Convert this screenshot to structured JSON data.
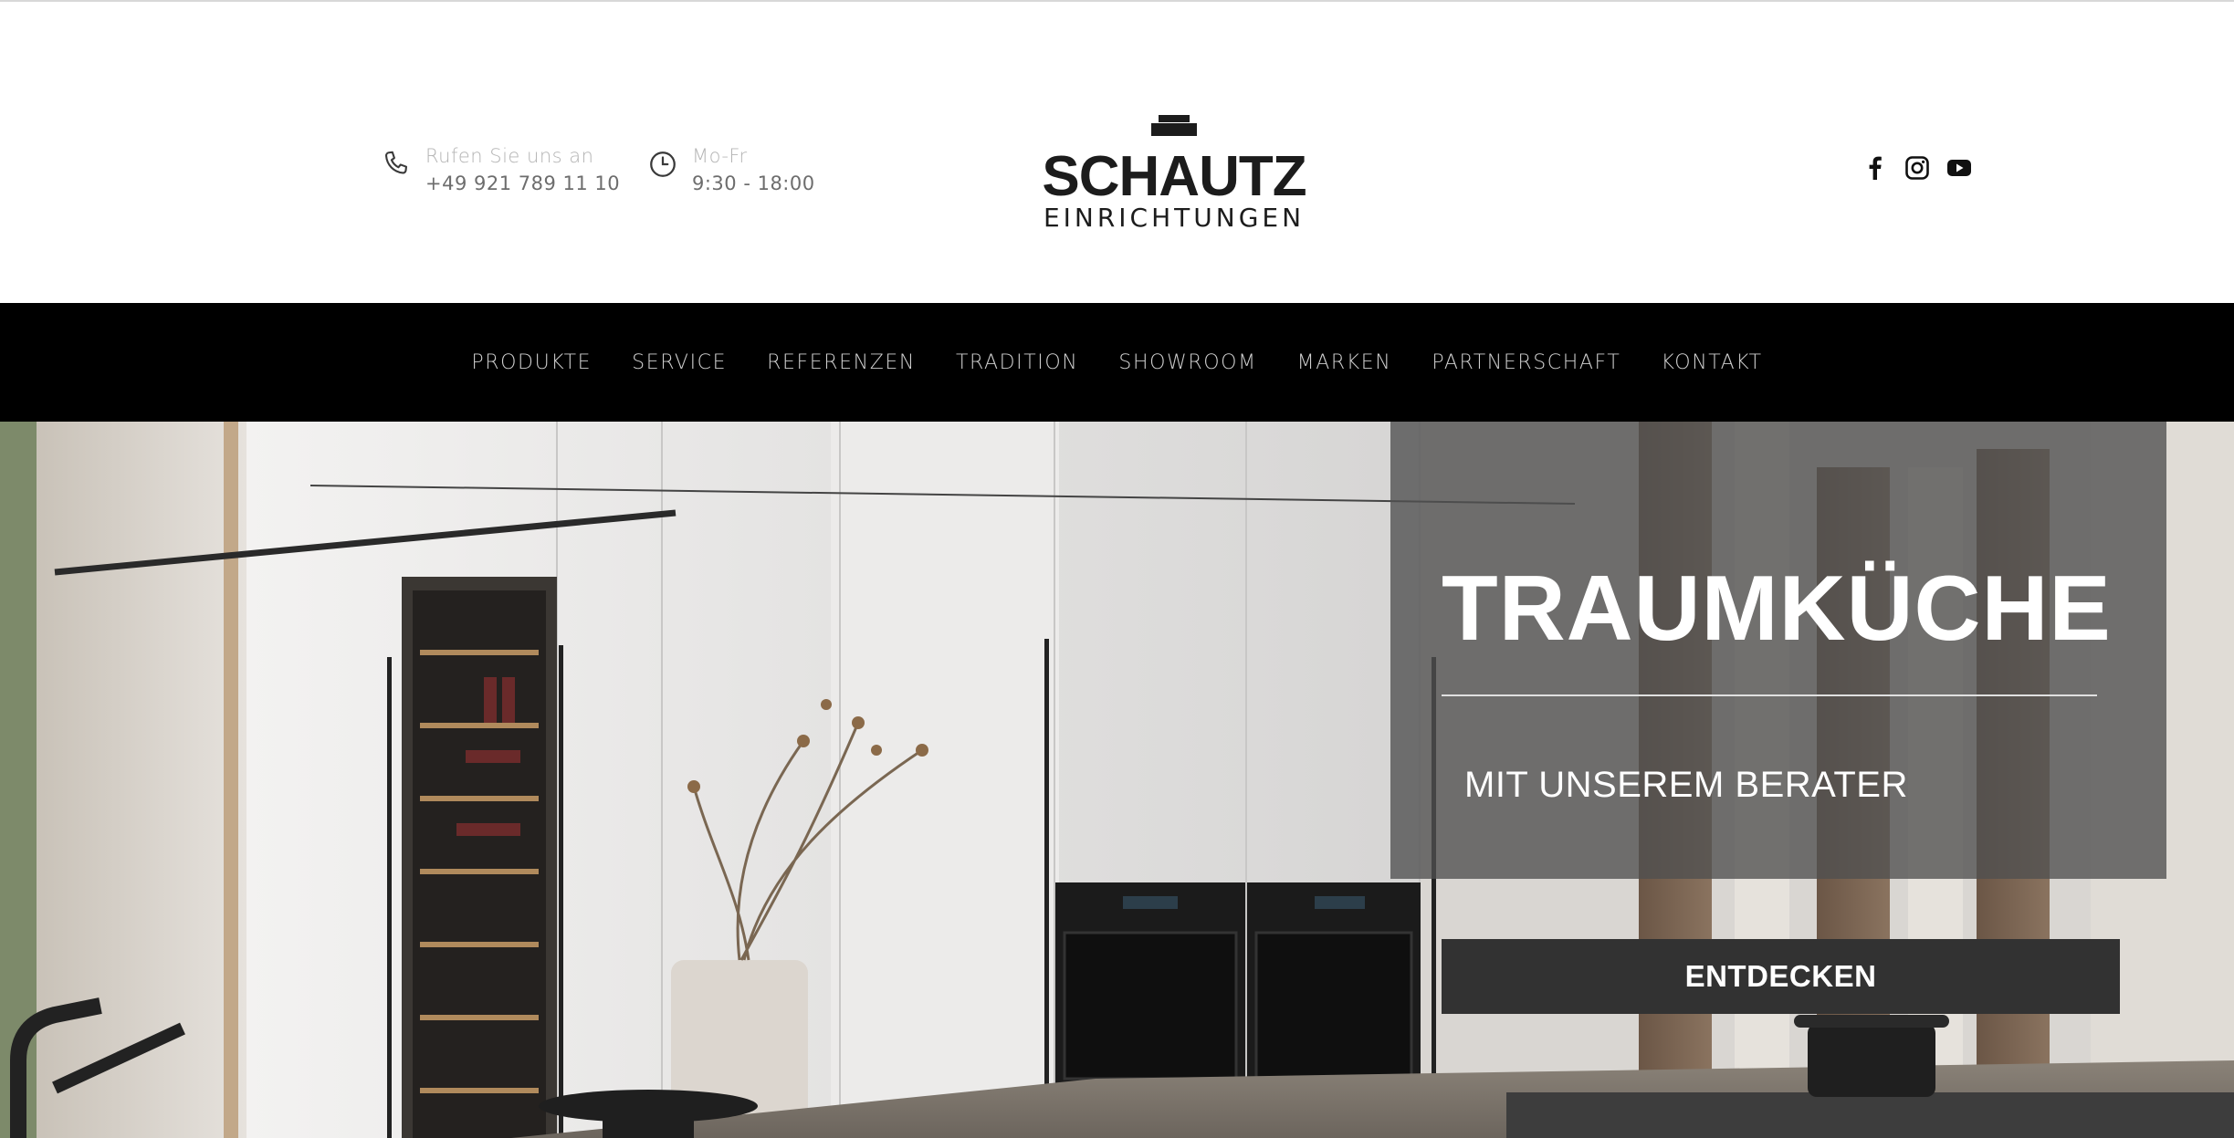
{
  "header": {
    "phone": {
      "icon": "phone-icon",
      "label": "Rufen Sie uns an",
      "number": "+49 921 789 11 10"
    },
    "hours": {
      "icon": "clock-icon",
      "label": "Mo-Fr",
      "time": "9:30 - 18:00"
    },
    "logo": {
      "name": "SCHAUTZ",
      "tagline": "EINRICHTUNGEN"
    },
    "social": [
      {
        "icon": "facebook-icon"
      },
      {
        "icon": "instagram-icon"
      },
      {
        "icon": "youtube-icon"
      }
    ]
  },
  "nav": {
    "items": [
      {
        "label": "PRODUKTE"
      },
      {
        "label": "SERVICE"
      },
      {
        "label": "REFERENZEN"
      },
      {
        "label": "TRADITION"
      },
      {
        "label": "SHOWROOM"
      },
      {
        "label": "MARKEN"
      },
      {
        "label": "PARTNERSCHAFT"
      },
      {
        "label": "KONTAKT"
      }
    ]
  },
  "hero": {
    "title": "TRAUMKÜCHE",
    "subtitle": "MIT UNSEREM BERATER",
    "cta_label": "ENTDECKEN"
  },
  "colors": {
    "nav_bg": "#000000",
    "overlay": "#505050",
    "cta_bg": "#323232",
    "text_light": "#ffffff"
  }
}
